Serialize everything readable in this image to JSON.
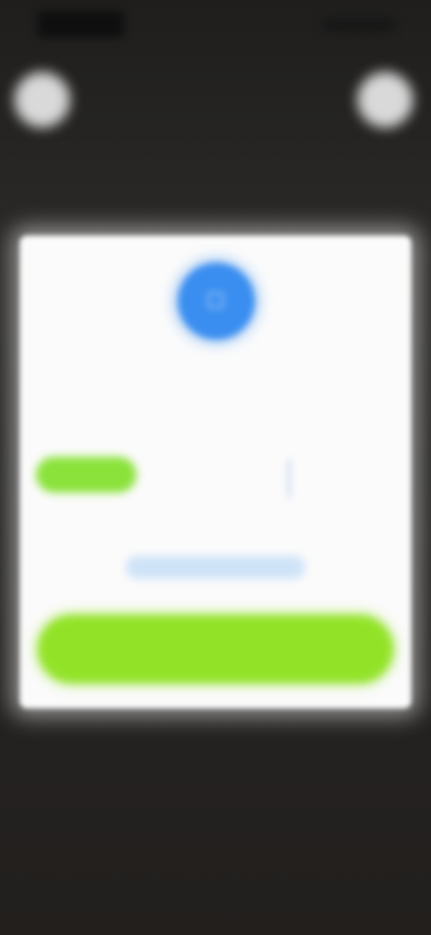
{
  "status_bar": {
    "time": "",
    "icons": [
      "signal-icon",
      "wifi-icon",
      "battery-icon"
    ]
  },
  "top_bar": {
    "left_button_icon": "close-icon",
    "right_button_icon": "more-icon"
  },
  "dialog": {
    "icon": "info-icon",
    "title": "",
    "description": "",
    "option_label": "",
    "link_label": "",
    "primary_label": ""
  },
  "colors": {
    "background": "#262524",
    "dialog": "#fbfbfb",
    "accent_blue": "#3a8ef0",
    "accent_green": "#92e328",
    "link_tint": "#cfe3f8"
  }
}
